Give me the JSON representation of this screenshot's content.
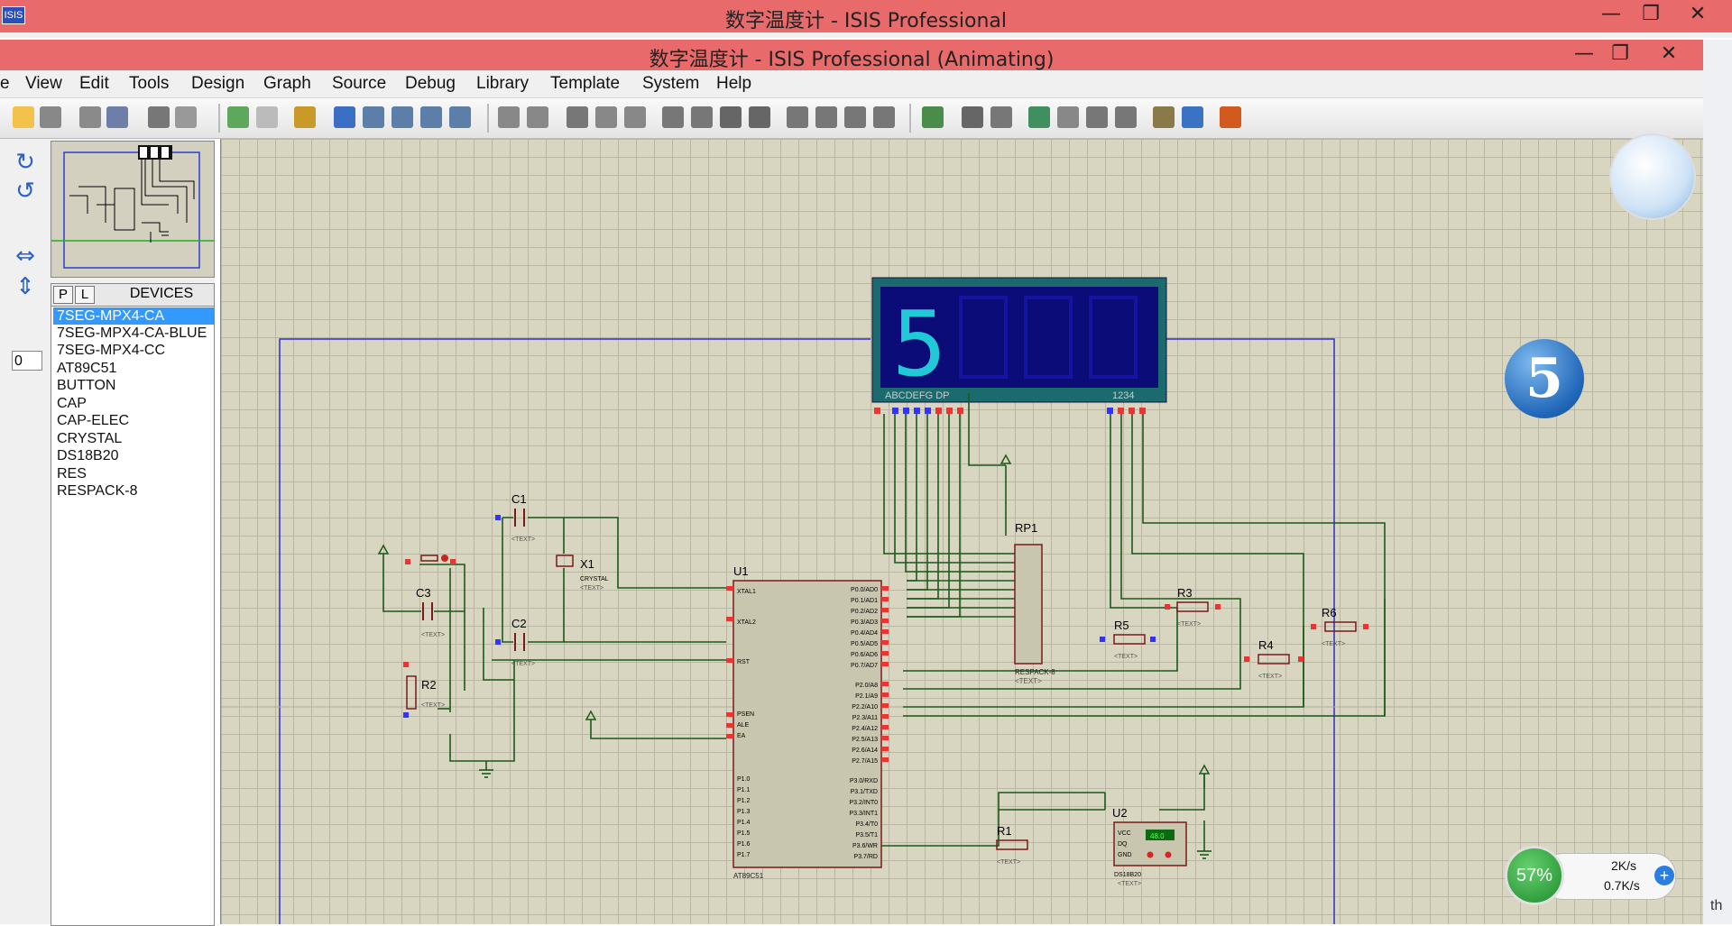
{
  "back_window": {
    "title": "数字温度计 - ISIS Professional",
    "icon_text": "ISIS",
    "buttons": [
      "—",
      "❐",
      "✕"
    ]
  },
  "front_window": {
    "title": "数字温度计 - ISIS Professional (Animating)",
    "buttons": [
      "—",
      "❐",
      "✕"
    ]
  },
  "menu": [
    "e",
    "View",
    "Edit",
    "Tools",
    "Design",
    "Graph",
    "Source",
    "Debug",
    "Library",
    "Template",
    "System",
    "Help"
  ],
  "left_tools": {
    "zoom_value": "0"
  },
  "devices": {
    "tab_p": "P",
    "tab_l": "L",
    "header": "DEVICES",
    "items": [
      "7SEG-MPX4-CA",
      "7SEG-MPX4-CA-BLUE",
      "7SEG-MPX4-CC",
      "AT89C51",
      "BUTTON",
      "CAP",
      "CAP-ELEC",
      "CRYSTAL",
      "DS18B20",
      "RES",
      "RESPACK-8"
    ],
    "selected_index": 0
  },
  "schematic": {
    "display": {
      "digit": "5",
      "pin_label_left": "ABCDEFG DP",
      "pin_label_right": "1234"
    },
    "components": [
      "C1",
      "C2",
      "C3",
      "X1",
      "R1",
      "R2",
      "R3",
      "R4",
      "R5",
      "R6",
      "RP1",
      "U1",
      "U2"
    ],
    "x1_value": "CRYSTAL",
    "rp1_value": "RESPACK-8",
    "text_placeholder": "<TEXT>",
    "u1_pins_left": [
      "XTAL1",
      "XTAL2",
      "RST",
      "PSEN",
      "ALE",
      "EA",
      "P1.0",
      "P1.1",
      "P1.2",
      "P1.3",
      "P1.4",
      "P1.5",
      "P1.6",
      "P1.7"
    ],
    "u1_pins_right": [
      "P0.0/AD0",
      "P0.1/AD1",
      "P0.2/AD2",
      "P0.3/AD3",
      "P0.4/AD4",
      "P0.5/AD5",
      "P0.6/AD6",
      "P0.7/AD7",
      "P2.0/A8",
      "P2.1/A9",
      "P2.2/A10",
      "P2.3/A11",
      "P2.4/A12",
      "P2.5/A13",
      "P2.6/A14",
      "P2.7/A15",
      "P3.0/RXD",
      "P3.1/TXD",
      "P3.2/INT0",
      "P3.3/INT1",
      "P3.4/T0",
      "P3.5/T1",
      "P3.6/WR",
      "P3.7/RD"
    ],
    "u1_value": "AT89C51",
    "u2_pins": [
      "VCC",
      "DQ",
      "GND"
    ],
    "u2_value": "DS18B20",
    "u2_temp": "48.0"
  },
  "overlay": {
    "badge_digit": "5",
    "net_percent": "57%",
    "net_up": "2K/s",
    "net_down": "0.7K/s",
    "corner_text": "th"
  }
}
